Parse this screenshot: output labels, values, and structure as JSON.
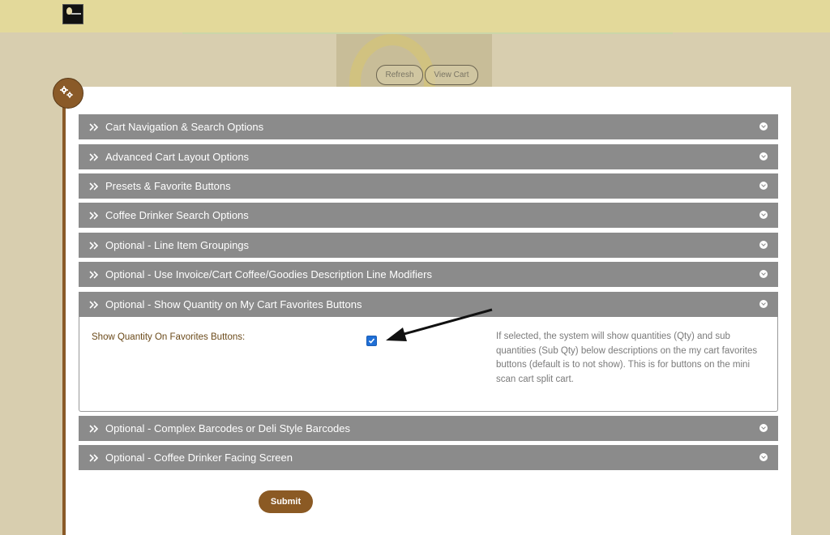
{
  "header": {
    "logo_icon": "store-logo"
  },
  "hero": {
    "refresh_label": "Refresh",
    "view_cart_label": "View Cart"
  },
  "badge_icon": "gears-icon",
  "accordion": {
    "sections": [
      {
        "title": "Cart Navigation & Search Options",
        "expanded": false
      },
      {
        "title": "Advanced Cart Layout Options",
        "expanded": false
      },
      {
        "title": "Presets & Favorite Buttons",
        "expanded": false
      },
      {
        "title": "Coffee Drinker Search Options",
        "expanded": false
      },
      {
        "title": "Optional - Line Item Groupings",
        "expanded": false
      },
      {
        "title": "Optional - Use Invoice/Cart Coffee/Goodies Description Line Modifiers",
        "expanded": false
      },
      {
        "title": "Optional - Show Quantity on My Cart Favorites Buttons",
        "expanded": true
      },
      {
        "title": "Optional - Complex Barcodes or Deli Style Barcodes",
        "expanded": false
      },
      {
        "title": "Optional - Coffee Drinker Facing Screen",
        "expanded": false
      }
    ],
    "open_section": {
      "field_label": "Show Quantity On Favorites Buttons:",
      "checkbox_checked": true,
      "help_text": "If selected, the system will show quantities (Qty) and sub quantities (Sub Qty) below descriptions on the my cart favorites buttons (default is to not show). This is for buttons on the mini scan cart split cart."
    }
  },
  "submit_label": "Submit",
  "colors": {
    "page_bg": "#d8ceaf",
    "topbar": "#e3d99a",
    "accordion_header": "#8b8b8b",
    "accent_brown": "#8b5a24",
    "checkbox_blue": "#1f6fd6"
  }
}
